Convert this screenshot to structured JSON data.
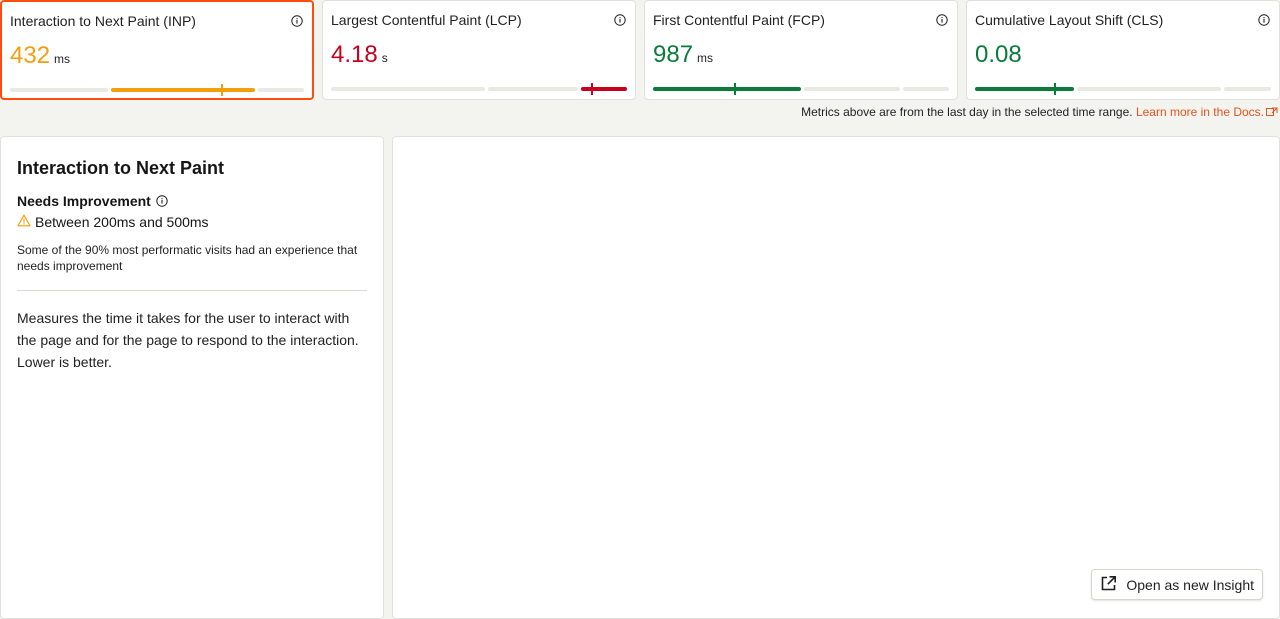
{
  "metrics": [
    {
      "title": "Interaction to Next Paint (INP)",
      "value": "432",
      "unit": "ms",
      "color": "#f59e0b",
      "selected": true,
      "status": "needs-improvement"
    },
    {
      "title": "Largest Contentful Paint (LCP)",
      "value": "4.18",
      "unit": "s",
      "color": "#c7001e",
      "selected": false,
      "status": "poor"
    },
    {
      "title": "First Contentful Paint (FCP)",
      "value": "987",
      "unit": "ms",
      "color": "#0a7b3b",
      "selected": false,
      "status": "good"
    },
    {
      "title": "Cumulative Layout Shift (CLS)",
      "value": "0.08",
      "unit": "",
      "color": "#0a7b3b",
      "selected": false,
      "status": "good"
    }
  ],
  "notice": {
    "text": "Metrics above are from the last day in the selected time range.",
    "link": "Learn more in the Docs.",
    "link_color": "#e8531b"
  },
  "detail": {
    "title": "Interaction to Next Paint",
    "status": "Needs Improvement",
    "range": "Between 200ms and 500ms",
    "note": "Some of the 90% most performatic visits had an experience that needs improvement",
    "description": "Measures the time it takes for the user to interact with the page and for the page to respond to the interaction. Lower is better.",
    "warning_color": "#f59e0b"
  },
  "chart_panel": {
    "open_button": "Open as new Insight"
  },
  "icons": {
    "info": "info-icon",
    "warning": "warning-triangle-icon",
    "external": "external-link-icon"
  },
  "colors": {
    "accent": "#ff4d0d",
    "good": "#0a7b3b",
    "needs_improvement": "#f59e0b",
    "poor": "#c7001e",
    "track": "#e9e9e4"
  }
}
